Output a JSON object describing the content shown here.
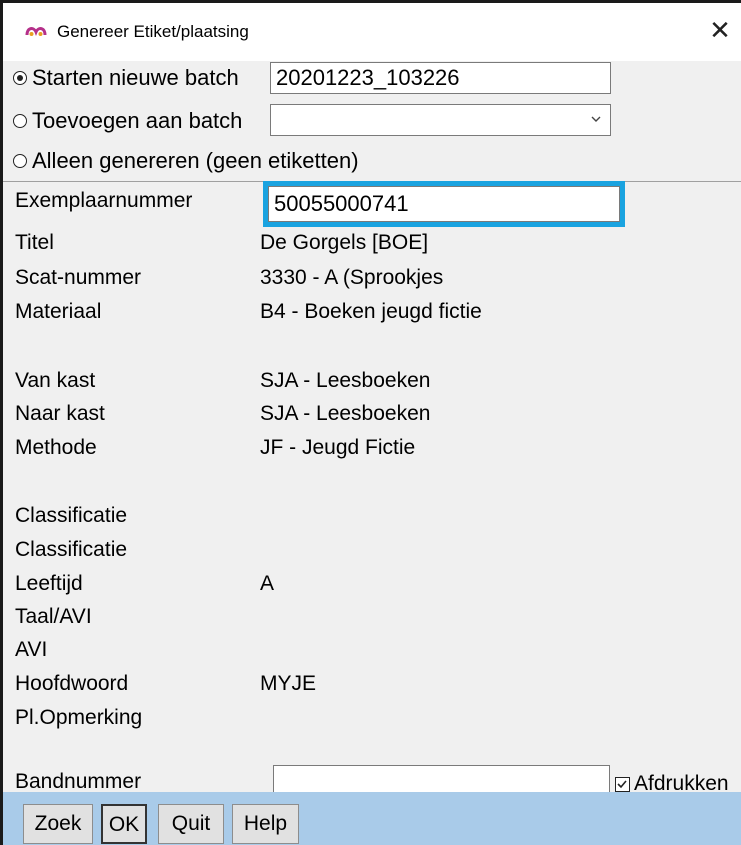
{
  "window": {
    "title": "Genereer Etiket/plaatsing",
    "close_glyph": "✕"
  },
  "batch": {
    "option_new_label": "Starten nieuwe batch",
    "option_new_value": "20201223_103226",
    "option_add_label": "Toevoegen aan batch",
    "option_add_value": "",
    "option_generate_only_label": "Alleen genereren (geen etiketten)",
    "selected": "new"
  },
  "fields": {
    "exemplaarnummer_label": "Exemplaarnummer",
    "exemplaarnummer_value": "50055000741",
    "titel_label": "Titel",
    "titel_value": "De Gorgels [BOE]",
    "scat_label": "Scat-nummer",
    "scat_value": "3330 - A (Sprookjes",
    "materiaal_label": "Materiaal",
    "materiaal_value": "B4 - Boeken jeugd fictie",
    "van_kast_label": "Van kast",
    "van_kast_value": "SJA - Leesboeken",
    "naar_kast_label": "Naar kast",
    "naar_kast_value": "SJA - Leesboeken",
    "methode_label": "Methode",
    "methode_value": "JF - Jeugd Fictie",
    "classificatie1_label": "Classificatie",
    "classificatie2_label": "Classificatie",
    "leeftijd_label": "Leeftijd",
    "leeftijd_value": "A",
    "taal_avi_label": "Taal/AVI",
    "avi_label": "AVI",
    "hoofdwoord_label": "Hoofdwoord",
    "hoofdwoord_value": "MYJE",
    "pl_opmerking_label": "Pl.Opmerking",
    "bandnummer_label": "Bandnummer",
    "bandnummer_value": "",
    "afdrukken_label": "Afdrukken",
    "afdrukken_checked": true
  },
  "buttons": {
    "zoek": "Zoek",
    "ok": "OK",
    "quit": "Quit",
    "help": "Help"
  },
  "colors": {
    "highlight": "#1aa3e0",
    "footer": "#a9cbe9",
    "icon_accent": "#b5308a"
  },
  "icons": {
    "app": "app-logo-icon",
    "close": "close-icon",
    "dropdown": "chevron-down-icon",
    "checkbox": "checkmark-icon"
  }
}
